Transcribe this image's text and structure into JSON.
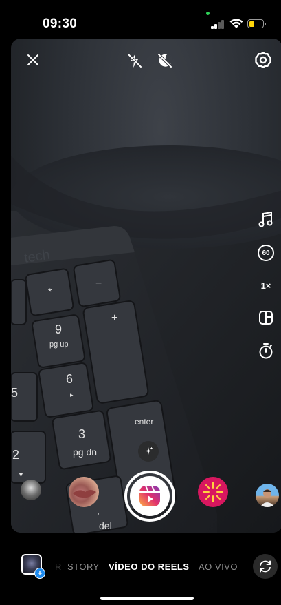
{
  "status_bar": {
    "time": "09:30",
    "battery_level": 0.4,
    "battery_color": "#ffd60a"
  },
  "camera_top": {
    "close_icon": "close-icon",
    "flash_icon": "flash-off-icon",
    "low_light_icon": "night-mode-off-icon",
    "settings_icon": "gear-icon"
  },
  "side_tools": {
    "audio_icon": "music-note-icon",
    "length_label": "60",
    "speed_label": "1×",
    "layout_icon": "layout-icon",
    "timer_icon": "timer-icon"
  },
  "effects": {
    "sparkle_icon": "sparkle-icon",
    "reel_icon": "reels-icon",
    "accent_gradient": [
      "#fcaf45",
      "#e1306c",
      "#833ab4"
    ]
  },
  "modes": {
    "partial_left": "R",
    "story": "STORY",
    "reels": "VÍDEO DO REELS",
    "live": "AO VIVO"
  },
  "bottom": {
    "gallery_plus": "+",
    "flip_icon": "flip-camera-icon"
  }
}
